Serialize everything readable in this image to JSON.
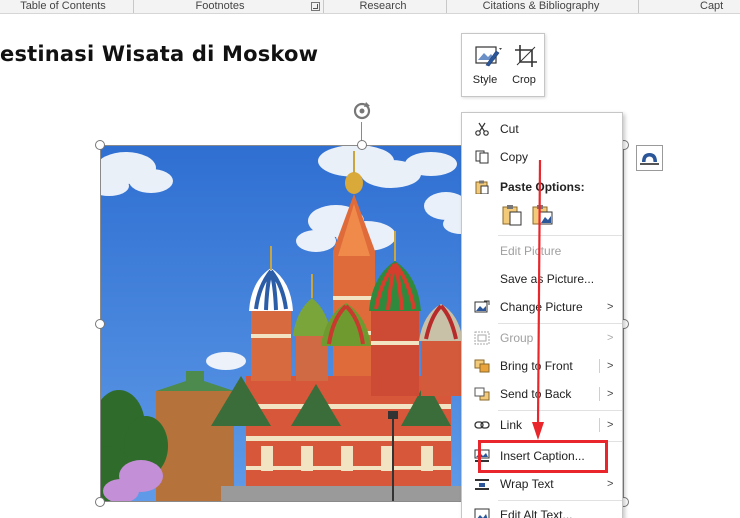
{
  "ribbon": {
    "groups": [
      {
        "label": "Table of Contents"
      },
      {
        "label": "Footnotes"
      },
      {
        "label": "Research"
      },
      {
        "label": "Citations & Bibliography"
      },
      {
        "label": "Capt"
      }
    ]
  },
  "document": {
    "heading": "estinasi Wisata di Moskow"
  },
  "mini_toolbar": {
    "style_label": "Style",
    "crop_label": "Crop"
  },
  "context_menu": {
    "items": {
      "cut": "Cut",
      "copy": "Copy",
      "paste_options": "Paste Options:",
      "edit_picture": "Edit Picture",
      "save_as_picture": "Save as Picture...",
      "change_picture": "Change Picture",
      "group": "Group",
      "bring_to_front": "Bring to Front",
      "send_to_back": "Send to Back",
      "link": "Link",
      "insert_caption": "Insert Caption...",
      "wrap_text": "Wrap Text",
      "edit_alt_text": "Edit Alt Text..."
    }
  },
  "icons": {
    "cut": "scissors-icon",
    "copy": "copy-icon",
    "paste": "clipboard-icon",
    "change_picture": "change-picture-icon",
    "group": "group-icon",
    "bring_to_front": "bring-to-front-icon",
    "send_to_back": "send-to-back-icon",
    "link": "link-icon",
    "insert_caption": "caption-icon",
    "wrap_text": "wrap-text-icon",
    "alt_text": "alt-text-icon",
    "rotate": "rotate-handle-icon",
    "layout_options": "layout-options-icon"
  },
  "colors": {
    "annotation": "#e8262b",
    "accent": "#2b579a"
  }
}
